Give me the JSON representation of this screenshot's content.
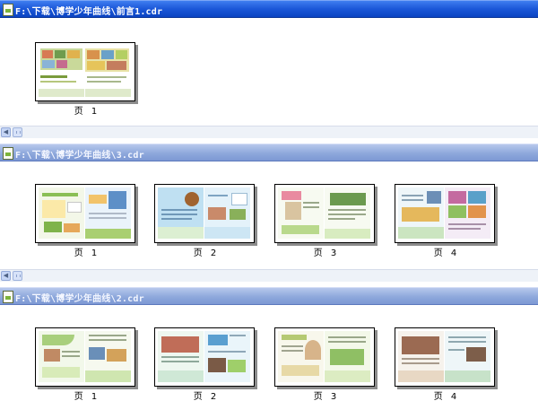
{
  "windows": [
    {
      "title": "F:\\下载\\博学少年曲线\\前言1.cdr",
      "active": true,
      "pages": [
        {
          "label": "页 1"
        }
      ]
    },
    {
      "title": "F:\\下载\\博学少年曲线\\3.cdr",
      "active": false,
      "pages": [
        {
          "label": "页 1"
        },
        {
          "label": "页 2"
        },
        {
          "label": "页 3"
        },
        {
          "label": "页 4"
        }
      ]
    },
    {
      "title": "F:\\下载\\博学少年曲线\\2.cdr",
      "active": false,
      "pages": [
        {
          "label": "页 1"
        },
        {
          "label": "页 2"
        },
        {
          "label": "页 3"
        },
        {
          "label": "页 4"
        }
      ]
    }
  ],
  "colors": {
    "active_titlebar": "#1b57d8",
    "inactive_titlebar": "#8ea8dc"
  },
  "icons": [
    "document-icon",
    "scroll-left-icon"
  ]
}
